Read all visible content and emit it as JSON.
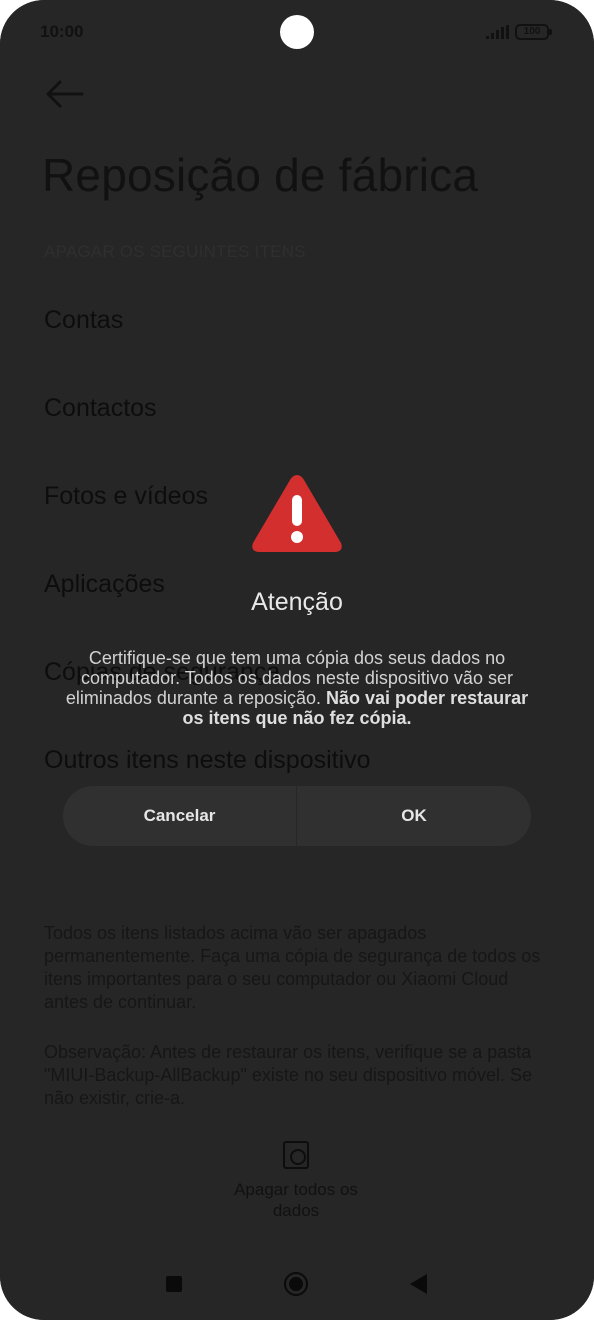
{
  "status_bar": {
    "time": "10:00",
    "battery": "100"
  },
  "page": {
    "title": "Reposição de fábrica",
    "section_label": "APAGAR OS SEGUINTES ITENS",
    "items": [
      "Contas",
      "Contactos",
      "Fotos e vídeos",
      "Aplicações",
      "Cópias de segurança",
      "Outros itens neste dispositivo"
    ],
    "info_paragraph_1": "Todos os itens listados acima vão ser apagados permanentemente. Faça uma cópia de segurança de todos os itens importantes para o seu computador ou Xiaomi Cloud antes de continuar.",
    "info_paragraph_2": "Observação: Antes de restaurar os itens, verifique se a pasta \"MIUI-Backup-AllBackup\" existe no seu dispositivo móvel. Se não existir, crie-a.",
    "erase_button_label": "Apagar todos os dados"
  },
  "dialog": {
    "title": "Atenção",
    "message_normal": "Certifique-se que tem uma cópia dos seus dados no computador. Todos os dados neste dispositivo vão ser eliminados durante a reposição. ",
    "message_bold": "Não vai poder restaurar os itens que não fez cópia.",
    "cancel_label": "Cancelar",
    "ok_label": "OK",
    "warning_color": "#d32f2f"
  }
}
